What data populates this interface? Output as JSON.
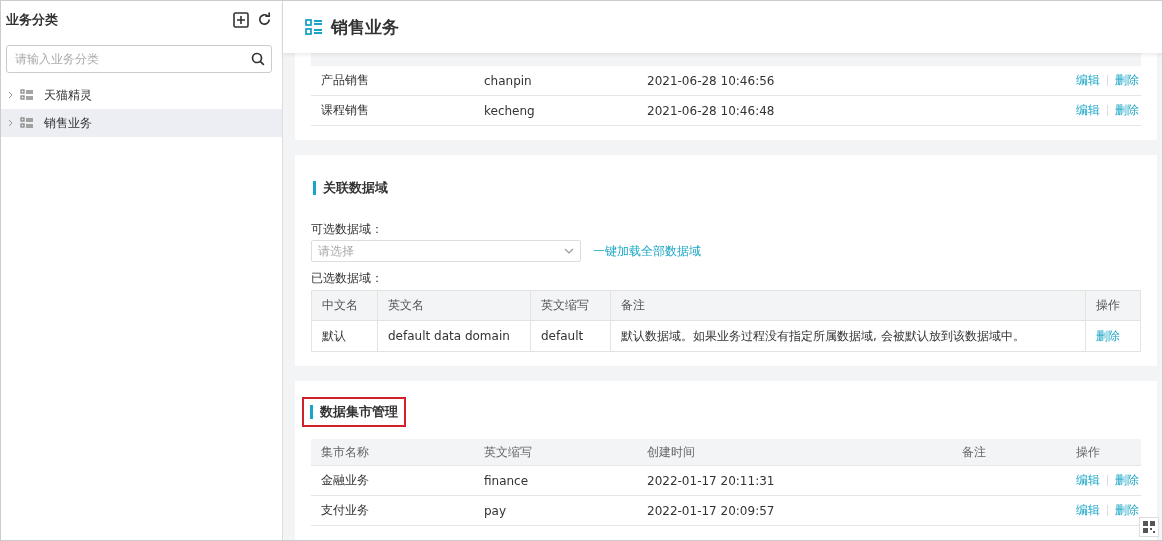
{
  "sidebar": {
    "title": "业务分类",
    "search": {
      "placeholder": "请输入业务分类"
    },
    "items": [
      {
        "label": "天猫精灵",
        "selected": false
      },
      {
        "label": "销售业务",
        "selected": true
      }
    ]
  },
  "page": {
    "title": "销售业务"
  },
  "business_table": {
    "rows": [
      {
        "cells": [
          "产品销售",
          "chanpin",
          "2021-06-28 10:46:56",
          ""
        ],
        "actions": [
          "编辑",
          "删除"
        ]
      },
      {
        "cells": [
          "课程销售",
          "kecheng",
          "2021-06-28 10:46:48",
          ""
        ],
        "actions": [
          "编辑",
          "删除"
        ]
      }
    ]
  },
  "domain_section": {
    "title": "关联数据域",
    "available_label": "可选数据域：",
    "select": {
      "placeholder": "请选择"
    },
    "load_all_link": "一键加载全部数据域",
    "selected_label": "已选数据域：",
    "columns": [
      "中文名",
      "英文名",
      "英文缩写",
      "备注",
      "操作"
    ],
    "rows": [
      {
        "cells": [
          "默认",
          "default data domain",
          "default",
          "默认数据域。如果业务过程没有指定所属数据域, 会被默认放到该数据域中。"
        ],
        "actions": [
          "删除"
        ]
      }
    ]
  },
  "mart_section": {
    "title": "数据集市管理",
    "highlighted": true,
    "columns": [
      "集市名称",
      "英文缩写",
      "创建时间",
      "备注",
      "操作"
    ],
    "rows": [
      {
        "cells": [
          "金融业务",
          "finance",
          "2022-01-17 20:11:31",
          ""
        ],
        "actions": [
          "编辑",
          "删除"
        ]
      },
      {
        "cells": [
          "支付业务",
          "pay",
          "2022-01-17 20:09:57",
          ""
        ],
        "actions": [
          "编辑",
          "删除"
        ]
      }
    ]
  }
}
